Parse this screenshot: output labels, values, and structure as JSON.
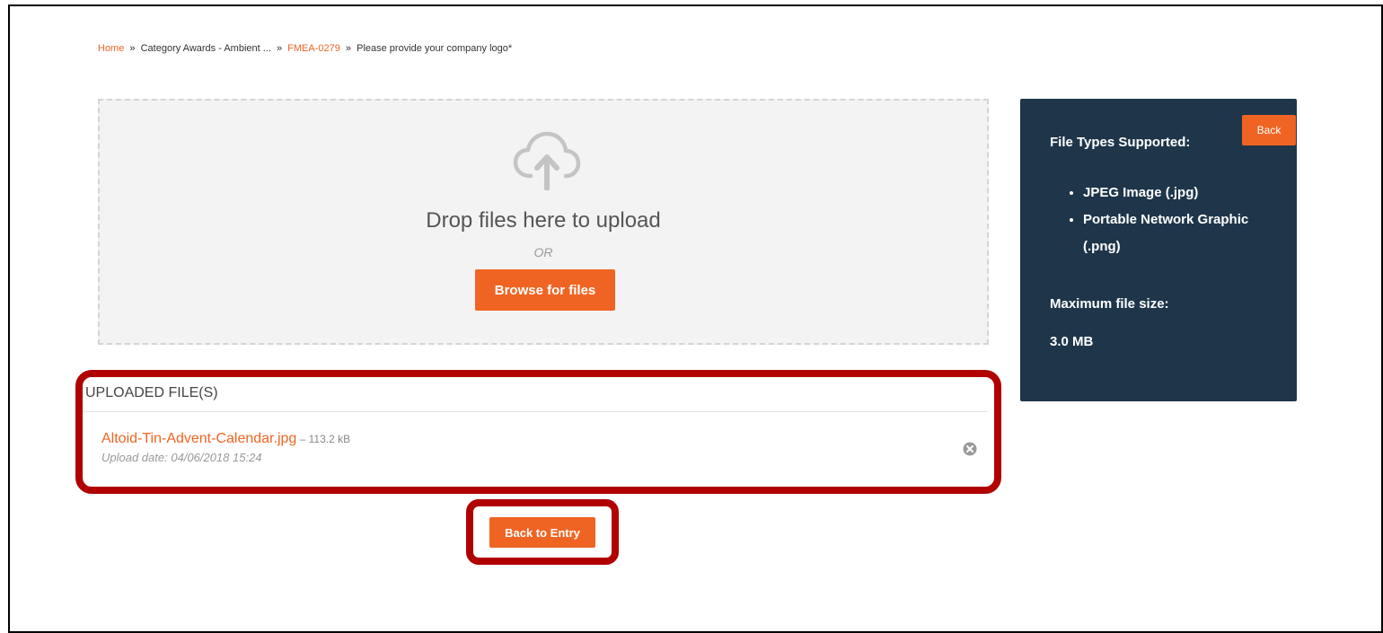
{
  "breadcrumb": {
    "home": "Home",
    "sep1": "»",
    "category": "Category Awards - Ambient ...",
    "sep2": "»",
    "entry": "FMEA-0279",
    "sep3": "»",
    "current": "Please provide your company logo*"
  },
  "dropzone": {
    "icon": "cloud-upload-icon",
    "drop_text": "Drop files here to upload",
    "or_text": "OR",
    "browse_label": "Browse for files"
  },
  "sidebar": {
    "back_label": "Back",
    "types_heading": "File Types Supported:",
    "types": [
      "JPEG Image (.jpg)",
      "Portable Network Graphic (.png)"
    ],
    "size_heading": "Maximum file size:",
    "size_value": "3.0 MB"
  },
  "uploaded": {
    "title": "UPLOADED FILE(S)",
    "files": [
      {
        "name": "Altoid-Tin-Advent-Calendar.jpg",
        "size": " – 113.2 kB",
        "date": "Upload date: 04/06/2018 15:24",
        "remove_icon": "remove-circle-icon"
      }
    ]
  },
  "footer": {
    "back_to_entry_label": "Back to Entry"
  },
  "colors": {
    "accent": "#f06423",
    "sidebar_bg": "#1f364a",
    "highlight": "#b00000"
  }
}
